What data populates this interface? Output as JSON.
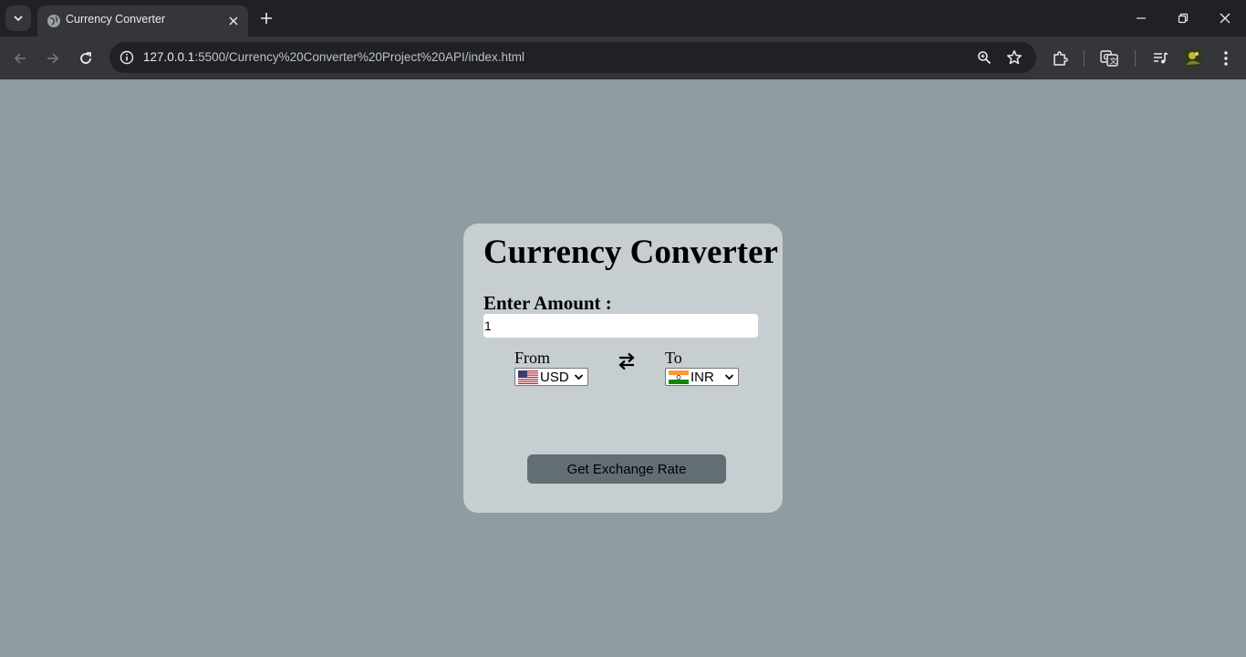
{
  "browser": {
    "tab": {
      "title": "Currency Converter"
    },
    "address_bar": {
      "url_host": "127.0.0.1",
      "url_path": ":5500/Currency%20Converter%20Project%20API/index.html"
    }
  },
  "page": {
    "title": "Currency Converter",
    "amount": {
      "label": "Enter Amount :",
      "value": "1"
    },
    "from": {
      "label": "From",
      "currency": "USD",
      "flag": "us-flag-icon"
    },
    "to": {
      "label": "To",
      "currency": "INR",
      "flag": "in-flag-icon"
    },
    "swap_icon": "arrows-exchange-icon",
    "message": "",
    "button_label": "Get Exchange Rate"
  },
  "colors": {
    "page_background": "#8d9da2",
    "card_background": "#c7ced1",
    "button_background": "#636e74"
  }
}
